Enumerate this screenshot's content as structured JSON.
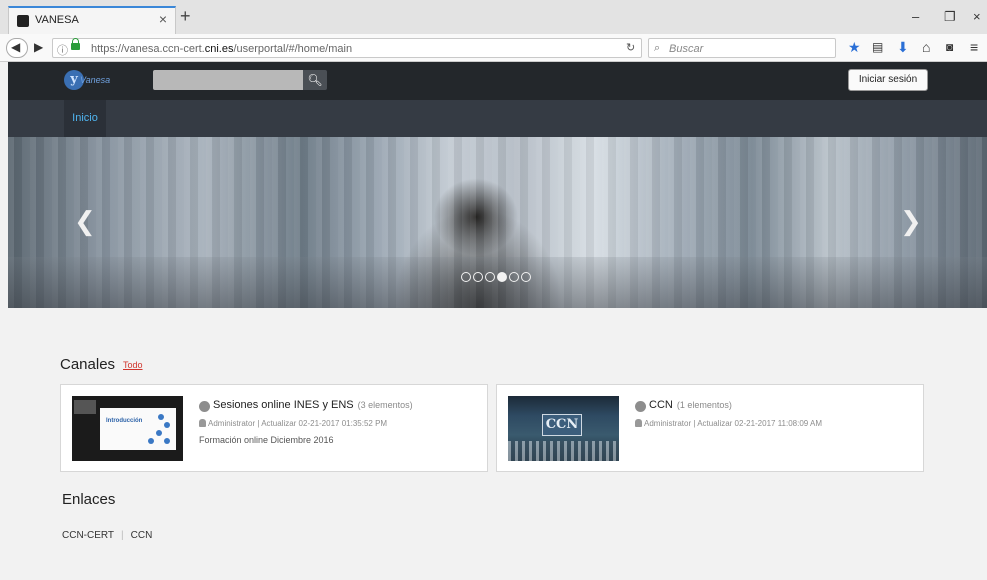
{
  "browser": {
    "tab_title": "VANESA",
    "tab_close": "×",
    "new_tab": "+",
    "url_prefix": "https://vanesa.ccn-cert.",
    "url_domain": "cni.es",
    "url_suffix": "/userportal/#/home/main",
    "search_placeholder": "Buscar",
    "window_controls": [
      "–",
      "❐",
      "×"
    ]
  },
  "header": {
    "logo_text": "Vanesa",
    "login_label": "Iniciar sesión"
  },
  "nav": {
    "items": [
      {
        "label": "Inicio",
        "active": true
      }
    ]
  },
  "carousel": {
    "dots_total": 6,
    "active_dot": 4
  },
  "canales": {
    "heading": "Canales",
    "todo_label": "Todo",
    "cards": [
      {
        "title": "Sesiones online INES y ENS",
        "count": "(3 elementos)",
        "meta": "Administrator | Actualizar 02-21-2017 01:35:52 PM",
        "description": "Formación online Diciembre 2016",
        "thumb_text": "Introducción"
      },
      {
        "title": "CCN",
        "count": "(1 elementos)",
        "meta": "Administrator | Actualizar 02-21-2017 11:08:09 AM",
        "description": "",
        "thumb_text": "CCN"
      }
    ]
  },
  "enlaces": {
    "heading": "Enlaces",
    "links": [
      "CCN-CERT",
      "CCN"
    ]
  },
  "colors": {
    "accent_tab": "#3a87d8",
    "header_bg": "#23272b",
    "nav_bg": "#353b44",
    "nav_active_text": "#4fb4ef",
    "todo_link": "#d0342c"
  }
}
